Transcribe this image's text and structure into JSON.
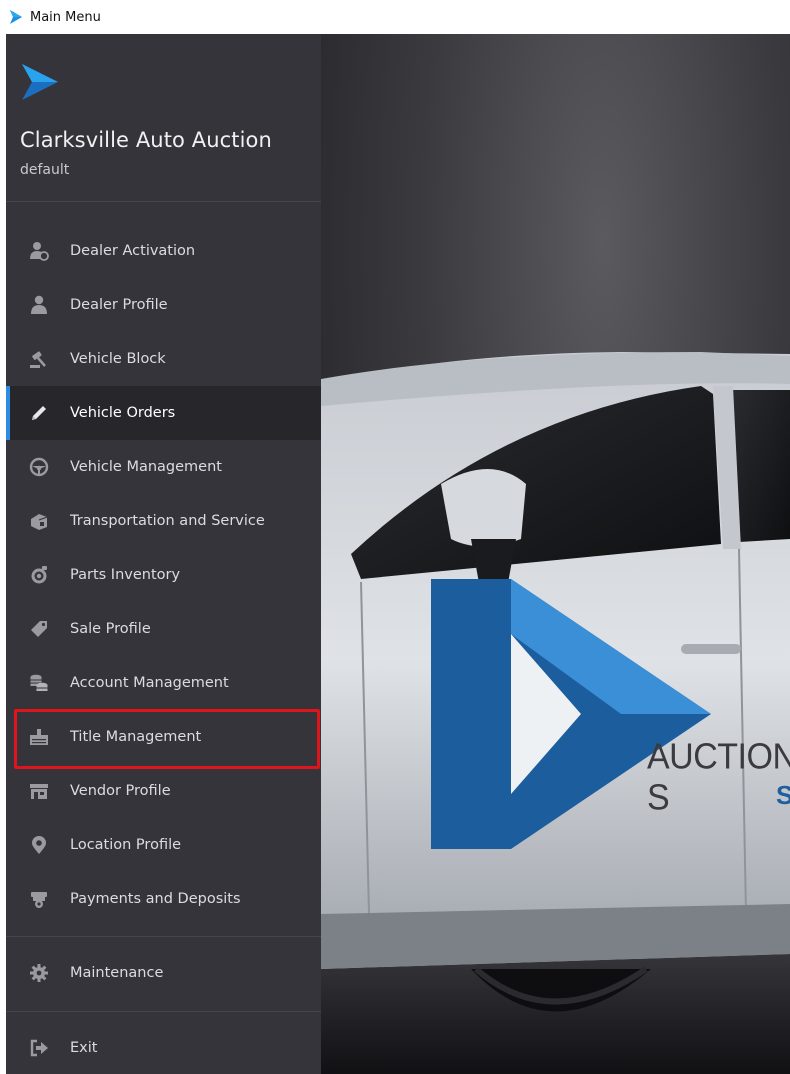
{
  "window": {
    "title": "Main Menu"
  },
  "sidebar": {
    "company_name": "Clarksville Auto Auction",
    "profile_name": "default",
    "items": [
      {
        "label": "Dealer Activation",
        "icon": "dealer-activation-icon"
      },
      {
        "label": "Dealer Profile",
        "icon": "user-icon"
      },
      {
        "label": "Vehicle Block",
        "icon": "gavel-icon"
      },
      {
        "label": "Vehicle Orders",
        "icon": "pencil-icon",
        "active": true
      },
      {
        "label": "Vehicle Management",
        "icon": "steering-wheel-icon"
      },
      {
        "label": "Transportation and Service",
        "icon": "truck-icon"
      },
      {
        "label": "Parts Inventory",
        "icon": "parts-icon"
      },
      {
        "label": "Sale Profile",
        "icon": "tag-icon"
      },
      {
        "label": "Account Management",
        "icon": "coins-icon"
      },
      {
        "label": "Title Management",
        "icon": "title-icon",
        "highlighted": true
      },
      {
        "label": "Vendor Profile",
        "icon": "store-icon"
      },
      {
        "label": "Location Profile",
        "icon": "map-pin-icon"
      },
      {
        "label": "Payments and Deposits",
        "icon": "payment-icon"
      }
    ],
    "maintenance_label": "Maintenance",
    "exit_label": "Exit"
  },
  "scene": {
    "brand_text_line1": "AUCTION S",
    "brand_text_line2": "S"
  },
  "colors": {
    "sidebar_bg": "#34343a",
    "active_bg": "#26262b",
    "active_accent": "#2d8ce2",
    "highlight_border": "#e0141b",
    "brand_blue": "#1f6fb8"
  }
}
